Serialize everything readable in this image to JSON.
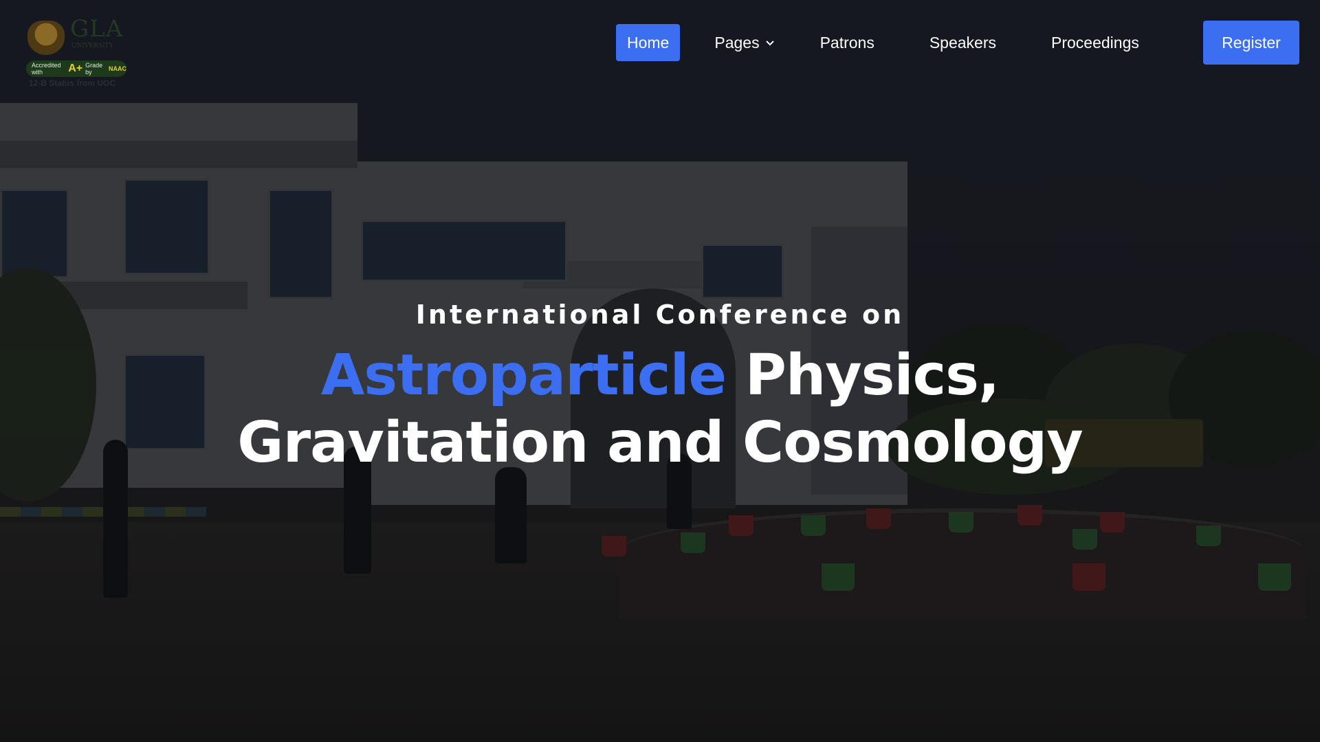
{
  "brand": {
    "university": "GLA",
    "university_sub": "UNIVERSITY",
    "accreditation_prefix": "Accredited with",
    "grade": "A+",
    "accreditation_suffix": "Grade by",
    "accreditor": "NAAC",
    "ugc_status": "12-B Status from UGC"
  },
  "nav": {
    "items": [
      {
        "label": "Home",
        "active": true
      },
      {
        "label": "Pages",
        "has_dropdown": true,
        "icon": "chevron-down-icon"
      },
      {
        "label": "Patrons"
      },
      {
        "label": "Speakers"
      },
      {
        "label": "Proceedings"
      }
    ],
    "register_label": "Register"
  },
  "hero": {
    "kicker": "International Conference on",
    "headline_accent": "Astroparticle",
    "headline_rest_line1": " Physics,",
    "headline_line2": "Gravitation and Cosmology"
  },
  "colors": {
    "accent": "#3b6ef0",
    "text": "#ffffff",
    "overlay": "#14171c"
  }
}
